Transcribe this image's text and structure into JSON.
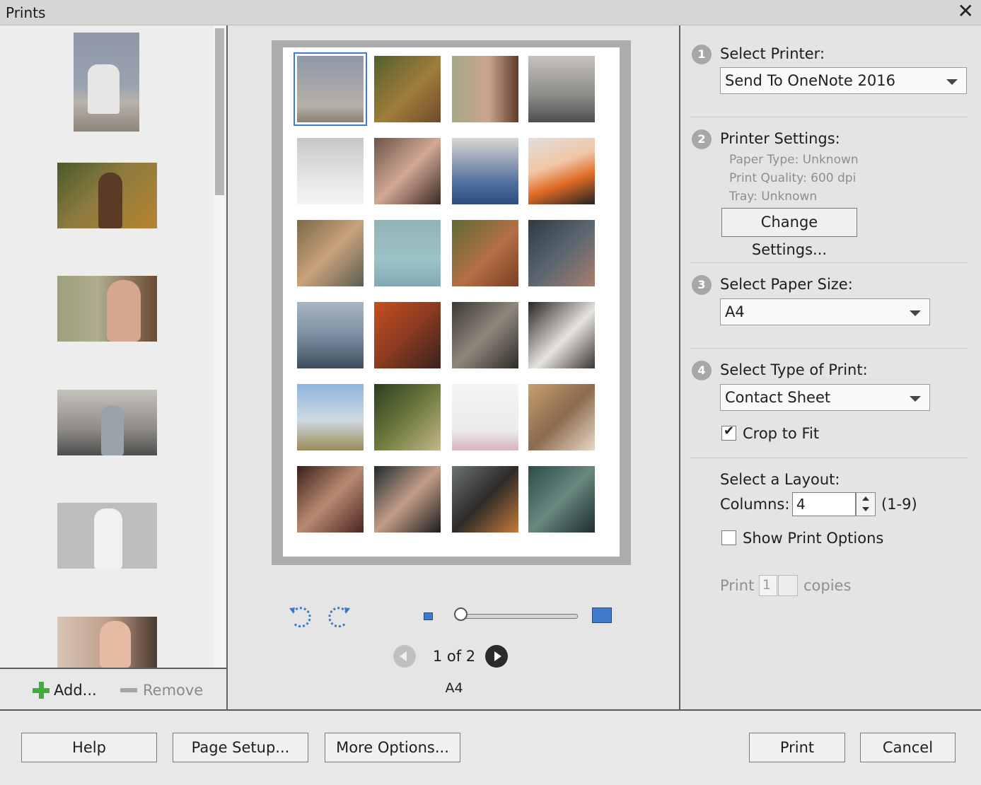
{
  "window": {
    "title": "Prints",
    "close": "✕"
  },
  "left_panel": {
    "add_label": "Add...",
    "remove_label": "Remove"
  },
  "center": {
    "page_info": "1 of 2",
    "paper_label": "A4"
  },
  "settings": {
    "printer": {
      "step": "1",
      "label": "Select Printer:",
      "value": "Send To OneNote 2016"
    },
    "printer_settings": {
      "step": "2",
      "label": "Printer Settings:",
      "paper_type": "Paper Type: Unknown",
      "print_quality": "Print Quality: 600 dpi",
      "tray": "Tray: Unknown",
      "change_button": "Change Settings..."
    },
    "paper_size": {
      "step": "3",
      "label": "Select Paper Size:",
      "value": "A4"
    },
    "print_type": {
      "step": "4",
      "label": "Select Type of Print:",
      "value": "Contact Sheet",
      "crop_label": "Crop to Fit",
      "crop_checked": true
    },
    "layout": {
      "label": "Select a Layout:",
      "columns_label": "Columns:",
      "columns_value": "4",
      "columns_range": "(1-9)"
    },
    "show_print_options": {
      "label": "Show Print Options",
      "checked": false
    },
    "copies": {
      "prefix": "Print",
      "value": "1",
      "suffix": "copies"
    }
  },
  "footer": {
    "help": "Help",
    "page_setup": "Page Setup...",
    "more_options": "More Options...",
    "print": "Print",
    "cancel": "Cancel"
  },
  "colors": {
    "accent": "#3b7ad9",
    "add_green": "#3fae3c"
  }
}
